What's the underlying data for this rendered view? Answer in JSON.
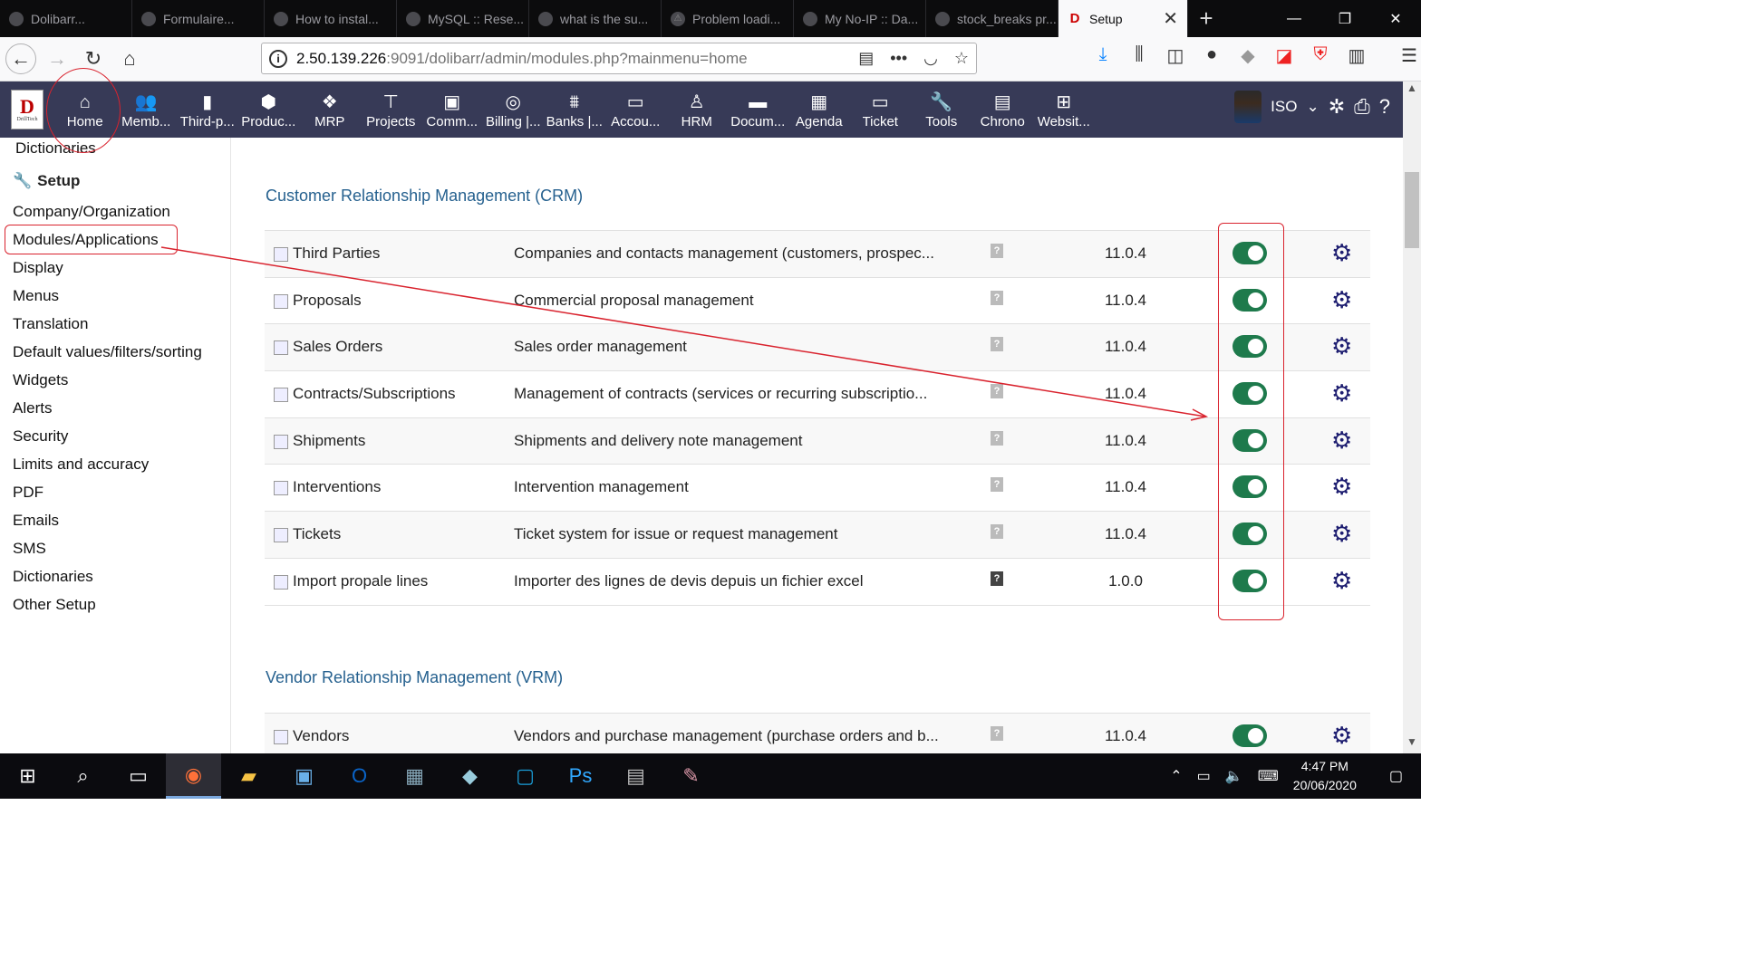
{
  "browser": {
    "tabs": [
      {
        "title": "Dolibarr..."
      },
      {
        "title": "Formulaire..."
      },
      {
        "title": "How to instal..."
      },
      {
        "title": "MySQL :: Rese..."
      },
      {
        "title": "what is the su..."
      },
      {
        "title": "Problem loadi..."
      },
      {
        "title": "My No-IP :: Da..."
      },
      {
        "title": "stock_breaks pr..."
      },
      {
        "title": "Setup",
        "active": true
      }
    ],
    "url_host": "2.50.139.226",
    "url_path": ":9091/dolibarr/admin/modules.php?mainmenu=home"
  },
  "app_menu": [
    {
      "label": "Home",
      "icon": "home-icon"
    },
    {
      "label": "Memb...",
      "icon": "users-icon"
    },
    {
      "label": "Third-p...",
      "icon": "building-icon"
    },
    {
      "label": "Produc...",
      "icon": "box-icon"
    },
    {
      "label": "MRP",
      "icon": "cubes-icon"
    },
    {
      "label": "Projects",
      "icon": "sitemap-icon"
    },
    {
      "label": "Comm...",
      "icon": "briefcase-icon"
    },
    {
      "label": "Billing |...",
      "icon": "coins-icon"
    },
    {
      "label": "Banks |...",
      "icon": "bank-icon"
    },
    {
      "label": "Accou...",
      "icon": "money-icon"
    },
    {
      "label": "HRM",
      "icon": "user-tie-icon"
    },
    {
      "label": "Docum...",
      "icon": "folder-icon"
    },
    {
      "label": "Agenda",
      "icon": "calendar-icon"
    },
    {
      "label": "Ticket",
      "icon": "ticket-icon"
    },
    {
      "label": "Tools",
      "icon": "wrench-icon"
    },
    {
      "label": "Chrono",
      "icon": "chrono-icon"
    },
    {
      "label": "Websit...",
      "icon": "website-icon"
    }
  ],
  "user": {
    "name": "ISO"
  },
  "left_menu": {
    "top_item": "Dictionaries",
    "section": "Setup",
    "items": [
      "Company/Organization",
      "Modules/Applications",
      "Display",
      "Menus",
      "Translation",
      "Default values/filters/sorting",
      "Widgets",
      "Alerts",
      "Security",
      "Limits and accuracy",
      "PDF",
      "Emails",
      "SMS",
      "Dictionaries",
      "Other Setup"
    ]
  },
  "sections": [
    {
      "title": "Customer Relationship Management (CRM)",
      "modules": [
        {
          "name": "Third Parties",
          "desc": "Companies and contacts management (customers, prospec...",
          "version": "11.0.4",
          "enabled": true
        },
        {
          "name": "Proposals",
          "desc": "Commercial proposal management",
          "version": "11.0.4",
          "enabled": true
        },
        {
          "name": "Sales Orders",
          "desc": "Sales order management",
          "version": "11.0.4",
          "enabled": true
        },
        {
          "name": "Contracts/Subscriptions",
          "desc": "Management of contracts (services or recurring subscriptio...",
          "version": "11.0.4",
          "enabled": true
        },
        {
          "name": "Shipments",
          "desc": "Shipments and delivery note management",
          "version": "11.0.4",
          "enabled": true
        },
        {
          "name": "Interventions",
          "desc": "Intervention management",
          "version": "11.0.4",
          "enabled": true
        },
        {
          "name": "Tickets",
          "desc": "Ticket system for issue or request management",
          "version": "11.0.4",
          "enabled": true
        },
        {
          "name": "Import propale lines",
          "desc": "Importer des lignes de devis depuis un fichier excel",
          "version": "1.0.0",
          "enabled": true
        }
      ]
    },
    {
      "title": "Vendor Relationship Management (VRM)",
      "modules": [
        {
          "name": "Vendors",
          "desc": "Vendors and purchase management (purchase orders and b...",
          "version": "11.0.4",
          "enabled": true
        }
      ]
    }
  ],
  "taskbar": {
    "time": "4:47 PM",
    "date": "20/06/2020"
  },
  "colors": {
    "app_bar": "#373a57",
    "section_title": "#26618f",
    "toggle_on": "#1e7a4c",
    "gear": "#1d1d70",
    "annotation": "#d9232e"
  }
}
